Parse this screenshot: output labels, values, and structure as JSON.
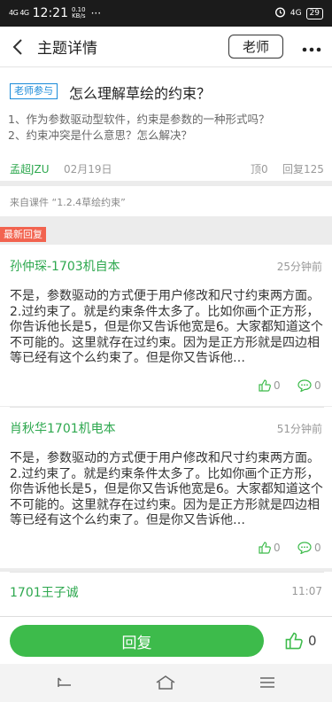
{
  "status_bar": {
    "signal": "4G 4G",
    "time": "12:21",
    "speed_value": "0.10",
    "speed_unit": "KB/s",
    "more": "···",
    "alarm_icon": "alarm-clock-icon",
    "network": "4G",
    "battery": "29"
  },
  "header": {
    "back_icon": "chevron-left-icon",
    "title": "主题详情",
    "teacher_label": "老师",
    "more_icon": "more-dots-icon"
  },
  "topic": {
    "tag": "老师参与",
    "title": "怎么理解草绘的约束？",
    "lines": [
      "1、作为参数驱动型软件，约束是参数的一种形式吗？",
      "2、约束冲突是什么意思？怎么解决？"
    ],
    "author": "孟超JZU",
    "date": "02月19日",
    "likes": "顶0",
    "replies": "回复125"
  },
  "source": "来自课件 “1.2.4草绘约束”",
  "latest_label": "最新回复",
  "replies": [
    {
      "name": "孙仲琛-1703机自本",
      "time": "25分钟前",
      "body": "不是，参数驱动的方式便于用户修改和尺寸约束两方面。2.过约束了。就是约束条件太多了。比如你画个正方形，你告诉他长是5，但是你又告诉他宽是6。大家都知道这个不可能的。这里就存在过约束。因为是正方形就是四边相等已经有这个么约束了。但是你又告诉他…",
      "likes": "0",
      "comments": "0"
    },
    {
      "name": "肖秋华1701机电本",
      "time": "51分钟前",
      "body": "不是，参数驱动的方式便于用户修改和尺寸约束两方面。2.过约束了。就是约束条件太多了。比如你画个正方形，你告诉他长是5，但是你又告诉他宽是6。大家都知道这个不可能的。这里就存在过约束。因为是正方形就是四边相等已经有这个么约束了。但是你又告诉他…",
      "likes": "0",
      "comments": "0"
    },
    {
      "name": "1701王子诚",
      "time": "11:07"
    }
  ],
  "bottom_bar": {
    "reply_label": "回复",
    "like_count": "0"
  },
  "nav": {
    "back_icon": "nav-back-icon",
    "home_icon": "nav-home-icon",
    "menu_icon": "nav-menu-icon"
  },
  "colors": {
    "green": "#2ea84f",
    "button_green": "#3dbb4b",
    "tag_blue": "#1a8bd9",
    "latest_red": "#f2634f"
  }
}
